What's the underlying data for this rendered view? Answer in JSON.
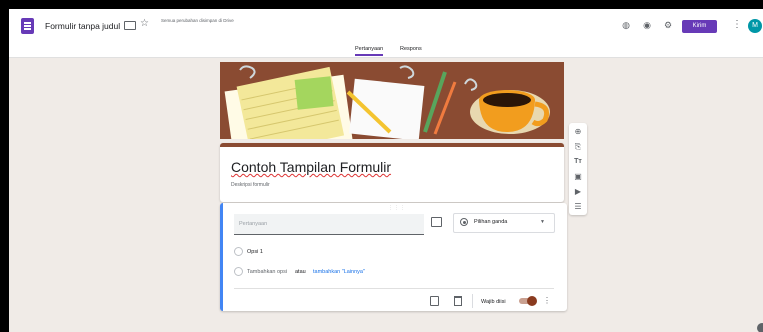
{
  "header": {
    "form_title": "Formulir tanpa judul",
    "save_status": "Semua perubahan disimpan di Drive",
    "send_label": "Kirim",
    "avatar_initial": "M",
    "icons": [
      "palette-icon",
      "preview-eye-icon",
      "settings-gear-icon",
      "more-vert-icon"
    ]
  },
  "tabs": [
    {
      "label": "Pertanyaan",
      "active": true
    },
    {
      "label": "Respons",
      "active": false
    }
  ],
  "form": {
    "title": "Contoh Tampilan Formulir",
    "description_placeholder": "Deskripsi formulir"
  },
  "question": {
    "placeholder": "Pertanyaan",
    "type": "Pilihan ganda",
    "options": [
      "Opsi 1"
    ],
    "add_option": "Tambahkan opsi",
    "or": "atau",
    "add_other": "tambahkan \"Lainnya\"",
    "required_label": "Wajib diisi",
    "required": true
  },
  "side_toolbar": [
    "add-question-icon",
    "import-questions-icon",
    "add-title-icon",
    "add-image-icon",
    "add-video-icon",
    "add-section-icon"
  ],
  "colors": {
    "accent": "#673ab7",
    "theme": "#8a4b32",
    "bg": "#f0ebe7",
    "link": "#1a73e8"
  }
}
